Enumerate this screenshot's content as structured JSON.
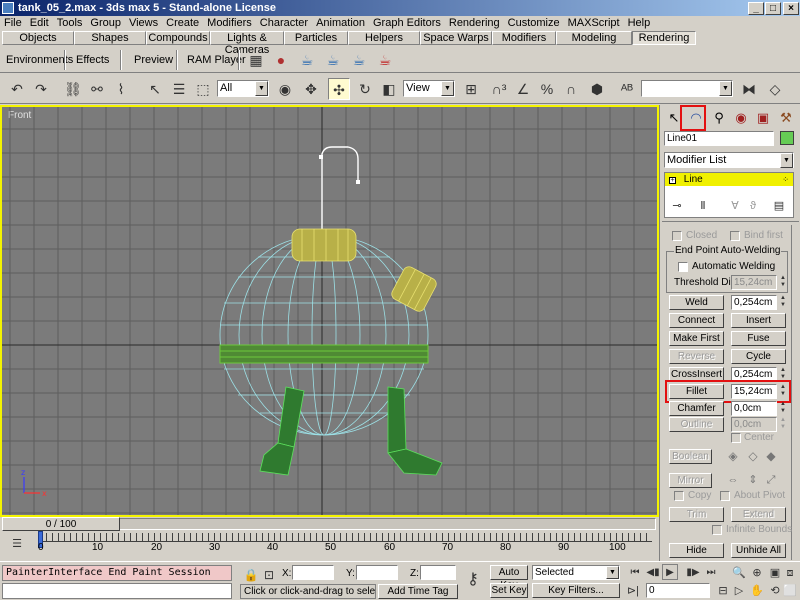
{
  "window": {
    "title": "tank_05_2.max - 3ds max 5 - Stand-alone License",
    "controls": [
      "_",
      "□",
      "×"
    ]
  },
  "menubar": [
    "File",
    "Edit",
    "Tools",
    "Group",
    "Views",
    "Create",
    "Modifiers",
    "Character",
    "Animation",
    "Graph Editors",
    "Rendering",
    "Customize",
    "MAXScript",
    "Help"
  ],
  "tabpanel": [
    "Objects",
    "Shapes",
    "Compounds",
    "Lights & Cameras",
    "Particles",
    "Helpers",
    "Space Warps",
    "Modifiers",
    "Modeling",
    "Rendering"
  ],
  "active_tab": "Rendering",
  "shelf": [
    "Environments",
    "Effects",
    "Preview",
    "RAM Player"
  ],
  "toolbar": {
    "selection_filter": "All",
    "coord_system": "View",
    "named_selection": ""
  },
  "viewport": {
    "label": "Front"
  },
  "command_panel": {
    "object_name": "Line01",
    "object_color": "#66cc55",
    "modifier_list": "Modifier List",
    "stack_item": "Line",
    "checks": {
      "closed": "Closed",
      "bind_first": "Bind first"
    },
    "group_label": "End Point Auto-Welding",
    "automatic_welding": "Automatic Welding",
    "threshold_label": "Threshold Dist.",
    "threshold_value": "15,24cm",
    "weld": "Weld",
    "weld_value": "0,254cm",
    "connect": "Connect",
    "insert": "Insert",
    "make_first": "Make First",
    "fuse": "Fuse",
    "reverse": "Reverse",
    "cycle": "Cycle",
    "crossinsert": "CrossInsert",
    "crossinsert_value": "0,254cm",
    "fillet": "Fillet",
    "fillet_value": "15,24cm",
    "chamfer": "Chamfer",
    "chamfer_value": "0,0cm",
    "outline": "Outline",
    "outline_value": "0,0cm",
    "center": "Center",
    "boolean": "Boolean",
    "mirror": "Mirror",
    "copy": "Copy",
    "about_pivot": "About Pivot",
    "trim": "Trim",
    "extend": "Extend",
    "infinite_bounds": "Infinite Bounds",
    "hide": "Hide",
    "unhide_all": "Unhide All"
  },
  "timeline": {
    "slider": "0 / 100",
    "ticks": [
      "0",
      "10",
      "20",
      "30",
      "40",
      "50",
      "60",
      "70",
      "80",
      "90",
      "100"
    ]
  },
  "status": {
    "maxscript": "PainterInterface End Paint Session",
    "prompt": "Click or click-and-drag to select obj",
    "add_time_tag": "Add Time Tag",
    "x_label": "X:",
    "y_label": "Y:",
    "z_label": "Z:",
    "auto_key": "Auto Key",
    "set_key": "Set Key",
    "key_mode": "Selected",
    "key_filters": "Key Filters...",
    "frame": "0"
  },
  "colors": {
    "highlight": "#e31010",
    "viewport_border": "#f4f400",
    "viewport_bg": "#7b7b7b"
  }
}
